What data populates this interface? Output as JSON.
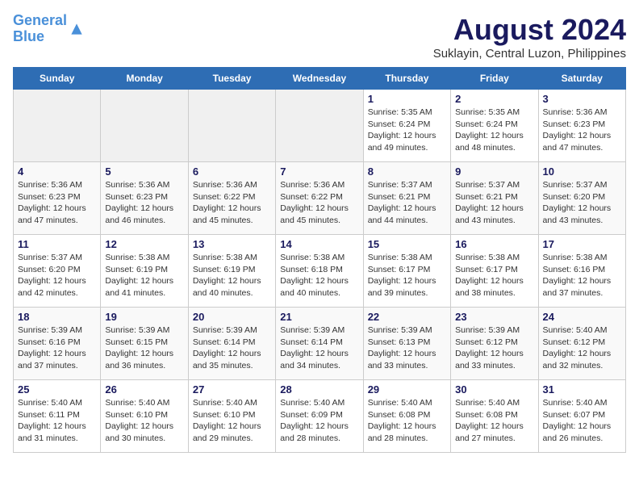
{
  "header": {
    "logo_line1": "General",
    "logo_line2": "Blue",
    "title": "August 2024",
    "subtitle": "Suklayin, Central Luzon, Philippines"
  },
  "days": [
    "Sunday",
    "Monday",
    "Tuesday",
    "Wednesday",
    "Thursday",
    "Friday",
    "Saturday"
  ],
  "weeks": [
    [
      {
        "day": "",
        "empty": true
      },
      {
        "day": "",
        "empty": true
      },
      {
        "day": "",
        "empty": true
      },
      {
        "day": "",
        "empty": true
      },
      {
        "day": "1",
        "line1": "Sunrise: 5:35 AM",
        "line2": "Sunset: 6:24 PM",
        "line3": "Daylight: 12 hours",
        "line4": "and 49 minutes."
      },
      {
        "day": "2",
        "line1": "Sunrise: 5:35 AM",
        "line2": "Sunset: 6:24 PM",
        "line3": "Daylight: 12 hours",
        "line4": "and 48 minutes."
      },
      {
        "day": "3",
        "line1": "Sunrise: 5:36 AM",
        "line2": "Sunset: 6:23 PM",
        "line3": "Daylight: 12 hours",
        "line4": "and 47 minutes."
      }
    ],
    [
      {
        "day": "4",
        "line1": "Sunrise: 5:36 AM",
        "line2": "Sunset: 6:23 PM",
        "line3": "Daylight: 12 hours",
        "line4": "and 47 minutes."
      },
      {
        "day": "5",
        "line1": "Sunrise: 5:36 AM",
        "line2": "Sunset: 6:23 PM",
        "line3": "Daylight: 12 hours",
        "line4": "and 46 minutes."
      },
      {
        "day": "6",
        "line1": "Sunrise: 5:36 AM",
        "line2": "Sunset: 6:22 PM",
        "line3": "Daylight: 12 hours",
        "line4": "and 45 minutes."
      },
      {
        "day": "7",
        "line1": "Sunrise: 5:36 AM",
        "line2": "Sunset: 6:22 PM",
        "line3": "Daylight: 12 hours",
        "line4": "and 45 minutes."
      },
      {
        "day": "8",
        "line1": "Sunrise: 5:37 AM",
        "line2": "Sunset: 6:21 PM",
        "line3": "Daylight: 12 hours",
        "line4": "and 44 minutes."
      },
      {
        "day": "9",
        "line1": "Sunrise: 5:37 AM",
        "line2": "Sunset: 6:21 PM",
        "line3": "Daylight: 12 hours",
        "line4": "and 43 minutes."
      },
      {
        "day": "10",
        "line1": "Sunrise: 5:37 AM",
        "line2": "Sunset: 6:20 PM",
        "line3": "Daylight: 12 hours",
        "line4": "and 43 minutes."
      }
    ],
    [
      {
        "day": "11",
        "line1": "Sunrise: 5:37 AM",
        "line2": "Sunset: 6:20 PM",
        "line3": "Daylight: 12 hours",
        "line4": "and 42 minutes."
      },
      {
        "day": "12",
        "line1": "Sunrise: 5:38 AM",
        "line2": "Sunset: 6:19 PM",
        "line3": "Daylight: 12 hours",
        "line4": "and 41 minutes."
      },
      {
        "day": "13",
        "line1": "Sunrise: 5:38 AM",
        "line2": "Sunset: 6:19 PM",
        "line3": "Daylight: 12 hours",
        "line4": "and 40 minutes."
      },
      {
        "day": "14",
        "line1": "Sunrise: 5:38 AM",
        "line2": "Sunset: 6:18 PM",
        "line3": "Daylight: 12 hours",
        "line4": "and 40 minutes."
      },
      {
        "day": "15",
        "line1": "Sunrise: 5:38 AM",
        "line2": "Sunset: 6:17 PM",
        "line3": "Daylight: 12 hours",
        "line4": "and 39 minutes."
      },
      {
        "day": "16",
        "line1": "Sunrise: 5:38 AM",
        "line2": "Sunset: 6:17 PM",
        "line3": "Daylight: 12 hours",
        "line4": "and 38 minutes."
      },
      {
        "day": "17",
        "line1": "Sunrise: 5:38 AM",
        "line2": "Sunset: 6:16 PM",
        "line3": "Daylight: 12 hours",
        "line4": "and 37 minutes."
      }
    ],
    [
      {
        "day": "18",
        "line1": "Sunrise: 5:39 AM",
        "line2": "Sunset: 6:16 PM",
        "line3": "Daylight: 12 hours",
        "line4": "and 37 minutes."
      },
      {
        "day": "19",
        "line1": "Sunrise: 5:39 AM",
        "line2": "Sunset: 6:15 PM",
        "line3": "Daylight: 12 hours",
        "line4": "and 36 minutes."
      },
      {
        "day": "20",
        "line1": "Sunrise: 5:39 AM",
        "line2": "Sunset: 6:14 PM",
        "line3": "Daylight: 12 hours",
        "line4": "and 35 minutes."
      },
      {
        "day": "21",
        "line1": "Sunrise: 5:39 AM",
        "line2": "Sunset: 6:14 PM",
        "line3": "Daylight: 12 hours",
        "line4": "and 34 minutes."
      },
      {
        "day": "22",
        "line1": "Sunrise: 5:39 AM",
        "line2": "Sunset: 6:13 PM",
        "line3": "Daylight: 12 hours",
        "line4": "and 33 minutes."
      },
      {
        "day": "23",
        "line1": "Sunrise: 5:39 AM",
        "line2": "Sunset: 6:12 PM",
        "line3": "Daylight: 12 hours",
        "line4": "and 33 minutes."
      },
      {
        "day": "24",
        "line1": "Sunrise: 5:40 AM",
        "line2": "Sunset: 6:12 PM",
        "line3": "Daylight: 12 hours",
        "line4": "and 32 minutes."
      }
    ],
    [
      {
        "day": "25",
        "line1": "Sunrise: 5:40 AM",
        "line2": "Sunset: 6:11 PM",
        "line3": "Daylight: 12 hours",
        "line4": "and 31 minutes."
      },
      {
        "day": "26",
        "line1": "Sunrise: 5:40 AM",
        "line2": "Sunset: 6:10 PM",
        "line3": "Daylight: 12 hours",
        "line4": "and 30 minutes."
      },
      {
        "day": "27",
        "line1": "Sunrise: 5:40 AM",
        "line2": "Sunset: 6:10 PM",
        "line3": "Daylight: 12 hours",
        "line4": "and 29 minutes."
      },
      {
        "day": "28",
        "line1": "Sunrise: 5:40 AM",
        "line2": "Sunset: 6:09 PM",
        "line3": "Daylight: 12 hours",
        "line4": "and 28 minutes."
      },
      {
        "day": "29",
        "line1": "Sunrise: 5:40 AM",
        "line2": "Sunset: 6:08 PM",
        "line3": "Daylight: 12 hours",
        "line4": "and 28 minutes."
      },
      {
        "day": "30",
        "line1": "Sunrise: 5:40 AM",
        "line2": "Sunset: 6:08 PM",
        "line3": "Daylight: 12 hours",
        "line4": "and 27 minutes."
      },
      {
        "day": "31",
        "line1": "Sunrise: 5:40 AM",
        "line2": "Sunset: 6:07 PM",
        "line3": "Daylight: 12 hours",
        "line4": "and 26 minutes."
      }
    ]
  ]
}
